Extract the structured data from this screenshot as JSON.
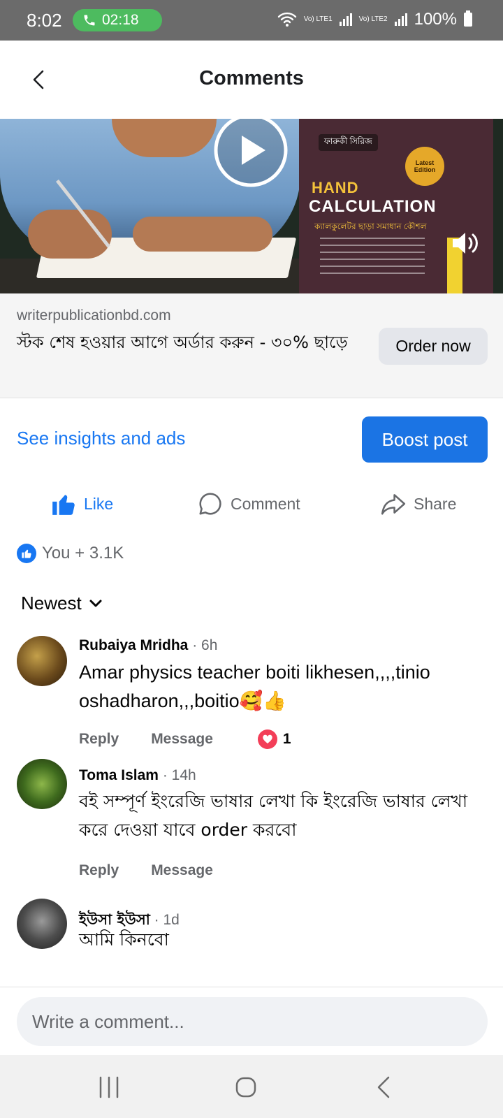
{
  "status_bar": {
    "time": "8:02",
    "call_timer": "02:18",
    "network1": "Vo) LTE1",
    "network2": "Vo) LTE2",
    "battery": "100%"
  },
  "header": {
    "title": "Comments"
  },
  "media": {
    "book_series": "ফারুকী সিরিজ",
    "book_title_1": "HAND",
    "book_title_2": "CALCULATION",
    "book_subtitle": "ক্যালকুলেটর ছাড়া সমাধান কৌশল",
    "book_edition": "Latest Edition"
  },
  "ad": {
    "domain": "writerpublicationbd.com",
    "headline": "স্টক শেষ হওয়ার আগে অর্ডার করুন - ৩০% ছাড়ে",
    "order_label": "Order now"
  },
  "insights_label": "See insights and ads",
  "boost_label": "Boost post",
  "actions": {
    "like": "Like",
    "comment": "Comment",
    "share": "Share"
  },
  "reactions_summary": "You + 3.1K",
  "sort_label": "Newest",
  "comments": [
    {
      "author": "Rubaiya Mridha",
      "time": "· 6h",
      "text": "Amar physics teacher boiti likhesen,,,,tinio oshadharon,,,boitio🥰👍",
      "reply": "Reply",
      "message": "Message",
      "reaction_count": "1"
    },
    {
      "author": "Toma Islam",
      "time": "· 14h",
      "text": "বই সম্পূর্ণ ইংরেজি ভাষার লেখা কি ইংরেজি ভাষার লেখা করে দেওয়া যাবে order করবো",
      "reply": "Reply",
      "message": "Message"
    },
    {
      "author": "ইউসা ইউসা",
      "time": "· 1d",
      "text": "আমি কিনবো"
    }
  ],
  "composer": {
    "placeholder": "Write a comment..."
  },
  "colors": {
    "brand_blue": "#1877f2",
    "boost_blue": "#1b74e4",
    "muted_text": "#65676b",
    "heart_red": "#f33e58"
  }
}
